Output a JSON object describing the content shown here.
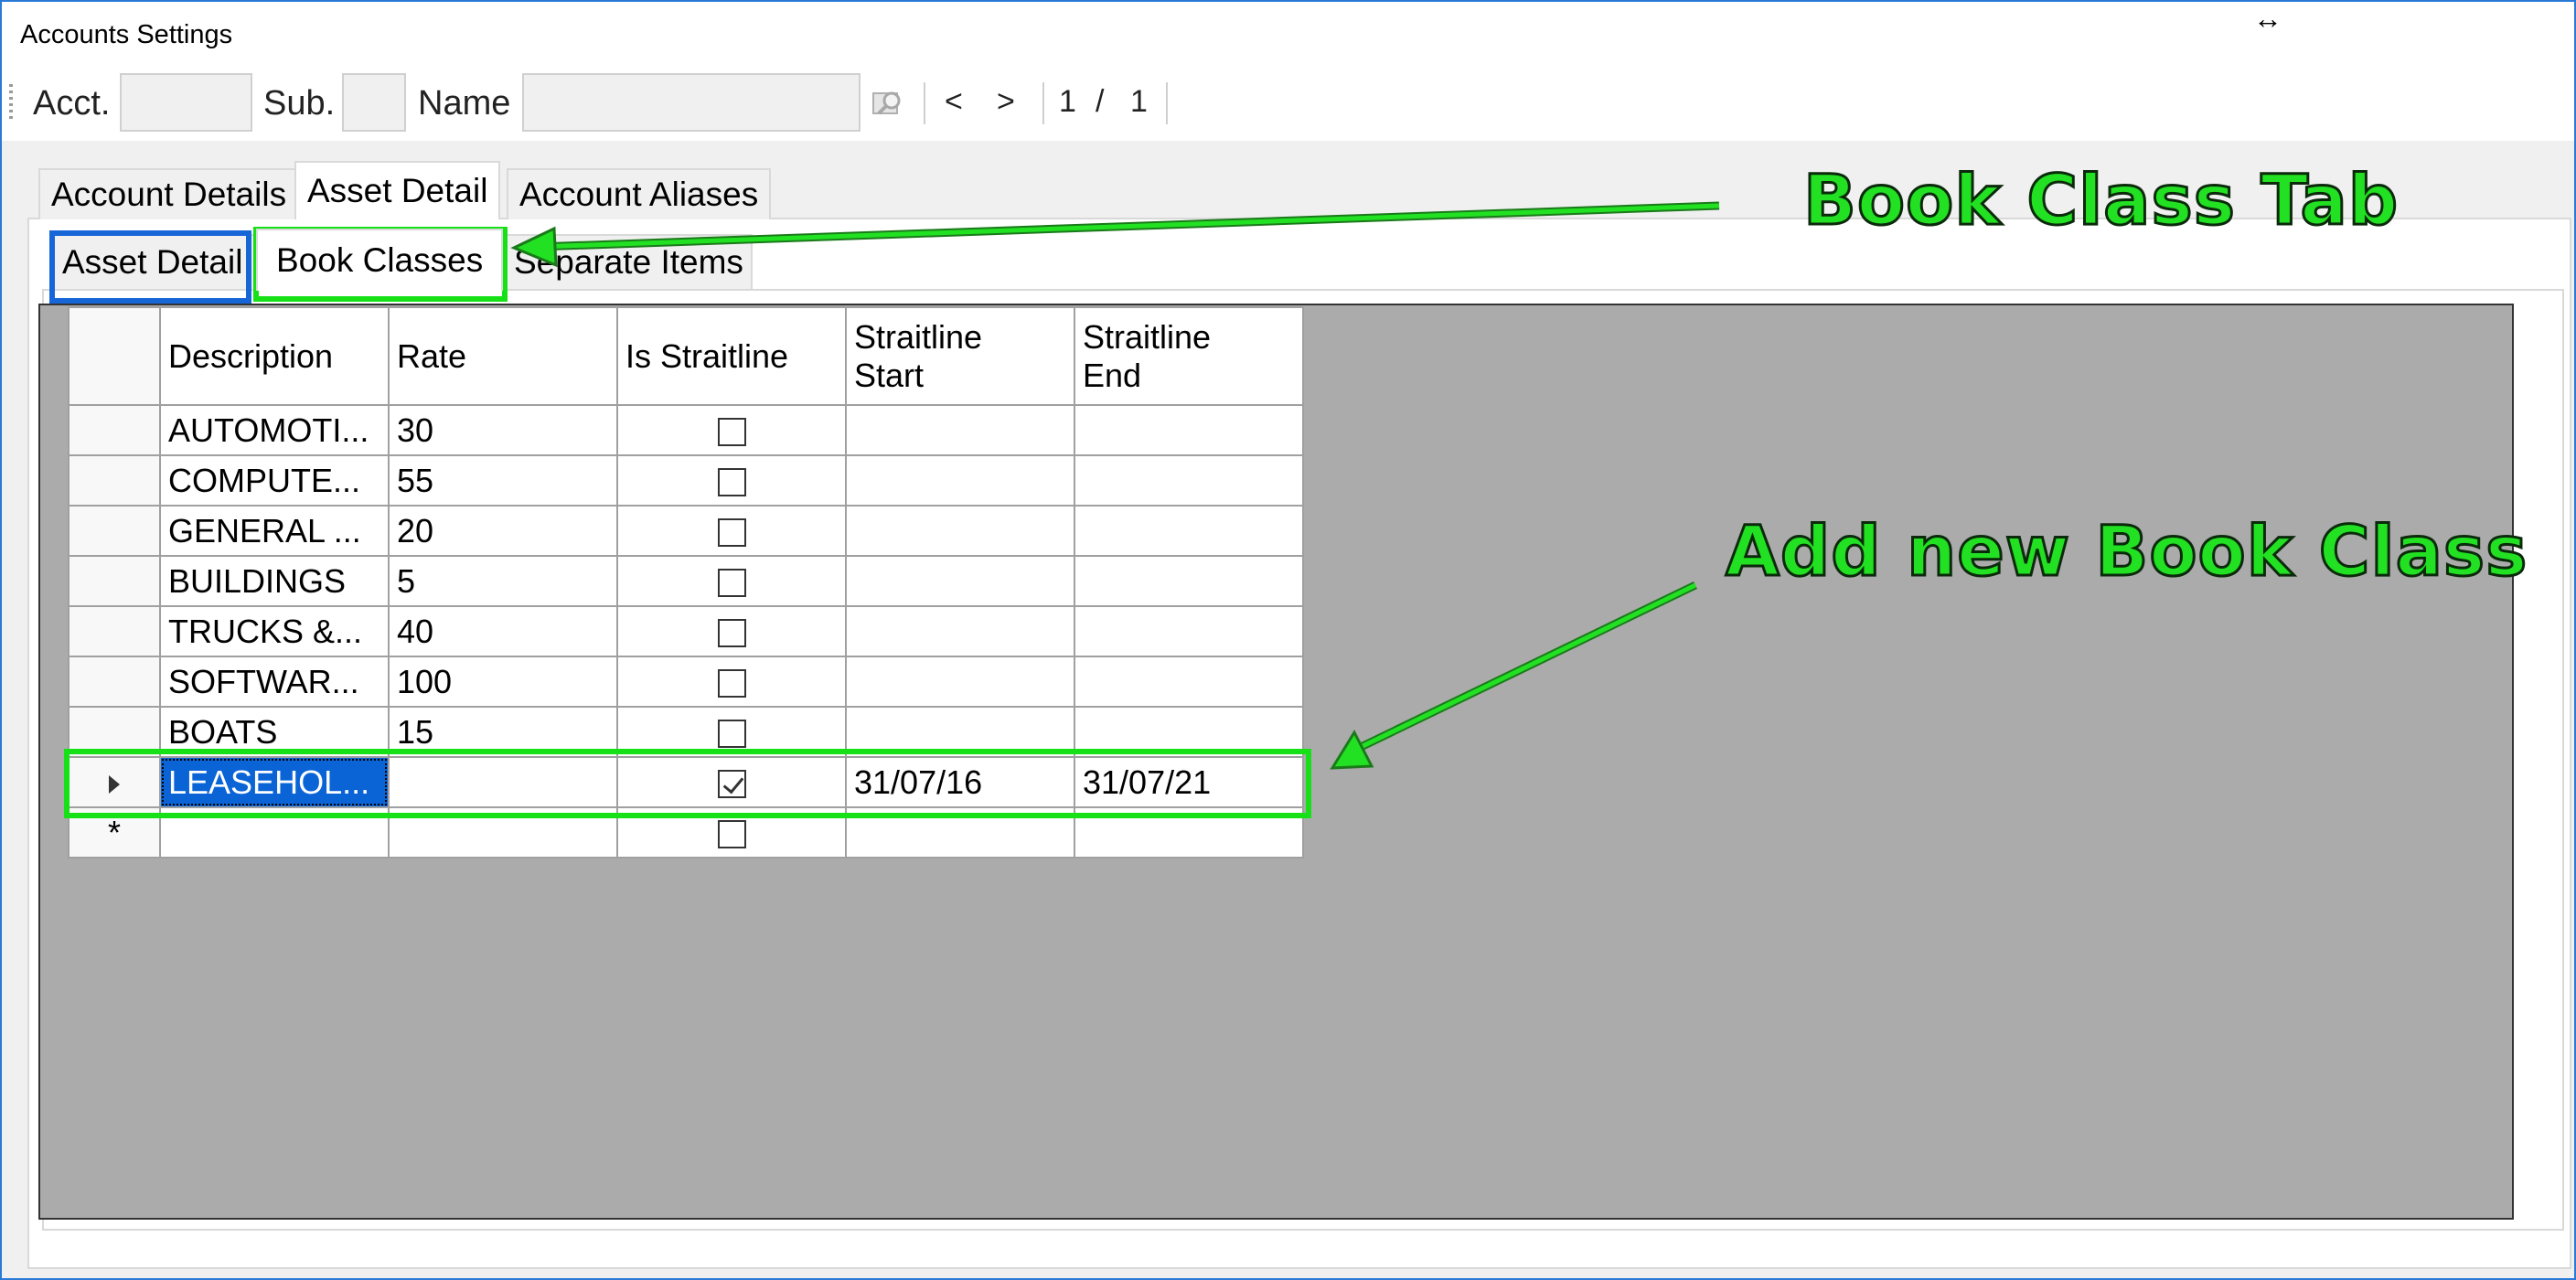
{
  "window": {
    "title": "Accounts Settings",
    "resize_icon": "↔"
  },
  "toolbar": {
    "acct_label": "Acct.",
    "sub_label": "Sub.",
    "name_label": "Name",
    "acct_value": "",
    "sub_value": "",
    "name_value": "",
    "find_icon": "find-icon",
    "prev_label": "<",
    "next_label": ">",
    "page_current": "1",
    "page_sep": "/",
    "page_total": "1"
  },
  "tabs": [
    {
      "label": "Account Details",
      "active": false
    },
    {
      "label": "Asset Detail",
      "active": true
    },
    {
      "label": "Account Aliases",
      "active": false
    }
  ],
  "subtabs": [
    {
      "label": "Asset Detail",
      "active": false
    },
    {
      "label": "Book Classes",
      "active": true
    },
    {
      "label": "Separate Items",
      "active": false
    }
  ],
  "grid": {
    "columns": [
      "Description",
      "Rate",
      "Is Straitline",
      "Straitline Start",
      "Straitline End"
    ],
    "column_lines": {
      "start_1": "Straitline",
      "start_2": "Start",
      "end_1": "Straitline",
      "end_2": "End"
    },
    "rows": [
      {
        "description": "AUTOMOTI...",
        "rate": "30",
        "is_straitline": false,
        "start": "",
        "end": ""
      },
      {
        "description": "COMPUTE...",
        "rate": "55",
        "is_straitline": false,
        "start": "",
        "end": ""
      },
      {
        "description": "GENERAL ...",
        "rate": "20",
        "is_straitline": false,
        "start": "",
        "end": ""
      },
      {
        "description": "BUILDINGS",
        "rate": "5",
        "is_straitline": false,
        "start": "",
        "end": ""
      },
      {
        "description": "TRUCKS &...",
        "rate": "40",
        "is_straitline": false,
        "start": "",
        "end": ""
      },
      {
        "description": "SOFTWAR...",
        "rate": "100",
        "is_straitline": false,
        "start": "",
        "end": ""
      },
      {
        "description": "BOATS",
        "rate": "15",
        "is_straitline": false,
        "start": "",
        "end": ""
      },
      {
        "description": "LEASEHOL...",
        "rate": "",
        "is_straitline": true,
        "start": "31/07/16",
        "end": "31/07/21"
      }
    ],
    "new_row_marker": "*",
    "current_row_marker": "▶"
  },
  "annotations": {
    "book_class_tab": "Book Class Tab",
    "add_new_book_class": "Add new Book Class"
  },
  "colors": {
    "annotation_green": "#22e022",
    "annotation_blue": "#1766d8",
    "selection_blue": "#0a64d6",
    "grid_background": "#ababab",
    "window_border": "#2b79d6"
  }
}
